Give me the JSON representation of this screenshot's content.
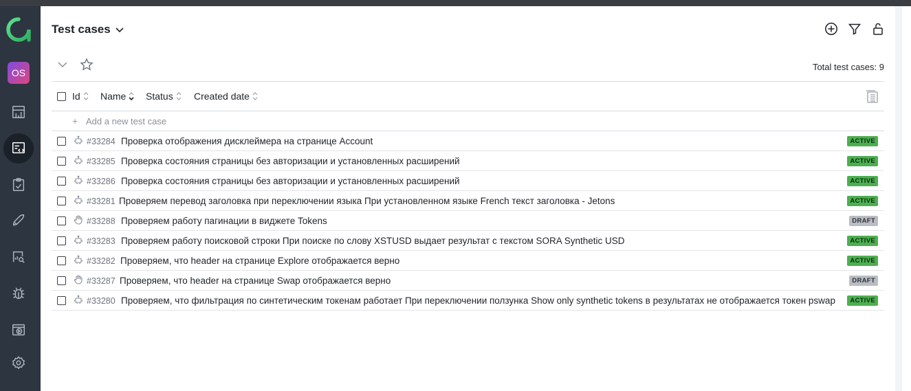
{
  "app": {
    "project_initials": "OS"
  },
  "page": {
    "title": "Test cases"
  },
  "toolbar": {
    "total_label": "Total test cases: 9"
  },
  "table": {
    "columns": [
      "Id",
      "Name",
      "Status",
      "Created date"
    ],
    "add_placeholder": "Add a new test case",
    "rows": [
      {
        "id": "#33284",
        "name": "Проверка отображения дисклеймера на странице Account",
        "status": "ACTIVE",
        "kind": "automated"
      },
      {
        "id": "#33285",
        "name": "Проверка состояния страницы без авторизации и установленных расширений",
        "status": "ACTIVE",
        "kind": "automated"
      },
      {
        "id": "#33286",
        "name": "Проверка состояния страницы без авторизации и установленных расширений",
        "status": "ACTIVE",
        "kind": "automated"
      },
      {
        "id": "#33281",
        "name": "Проверяем перевод заголовка при переключении языка При установленном языке French текст заголовка - Jetons",
        "status": "ACTIVE",
        "kind": "automated"
      },
      {
        "id": "#33288",
        "name": "Проверяем работу пагинации в виджете Tokens",
        "status": "DRAFT",
        "kind": "manual"
      },
      {
        "id": "#33283",
        "name": "Проверяем работу поисковой строки При поиске по слову XSTUSD выдает результат с текстом SORA Synthetic USD",
        "status": "ACTIVE",
        "kind": "automated"
      },
      {
        "id": "#33282",
        "name": "Проверяем, что header на странице Explore отображается верно",
        "status": "ACTIVE",
        "kind": "automated"
      },
      {
        "id": "#33287",
        "name": "Проверяем, что header на странице Swap отображается верно",
        "status": "DRAFT",
        "kind": "manual"
      },
      {
        "id": "#33280",
        "name": "Проверяем, что фильтрация по синтетическим токенам работает При переключении ползунка Show only synthetic tokens в результатах не отображается токен pswap",
        "status": "ACTIVE",
        "kind": "automated"
      }
    ]
  },
  "icons": {
    "logo": "allure-logo-icon",
    "nav": [
      "dashboard-icon",
      "test-cases-icon",
      "test-plans-icon",
      "launches-icon",
      "analytics-icon",
      "defects-icon",
      "jobs-icon",
      "settings-icon"
    ],
    "actions": [
      "add-circle-icon",
      "filter-icon",
      "unlock-icon"
    ]
  },
  "colors": {
    "sidebar": "#2d3540",
    "active_badge": "#4caf50",
    "draft_badge": "#b9bdc3",
    "logo_green": "#3fbf6a"
  }
}
